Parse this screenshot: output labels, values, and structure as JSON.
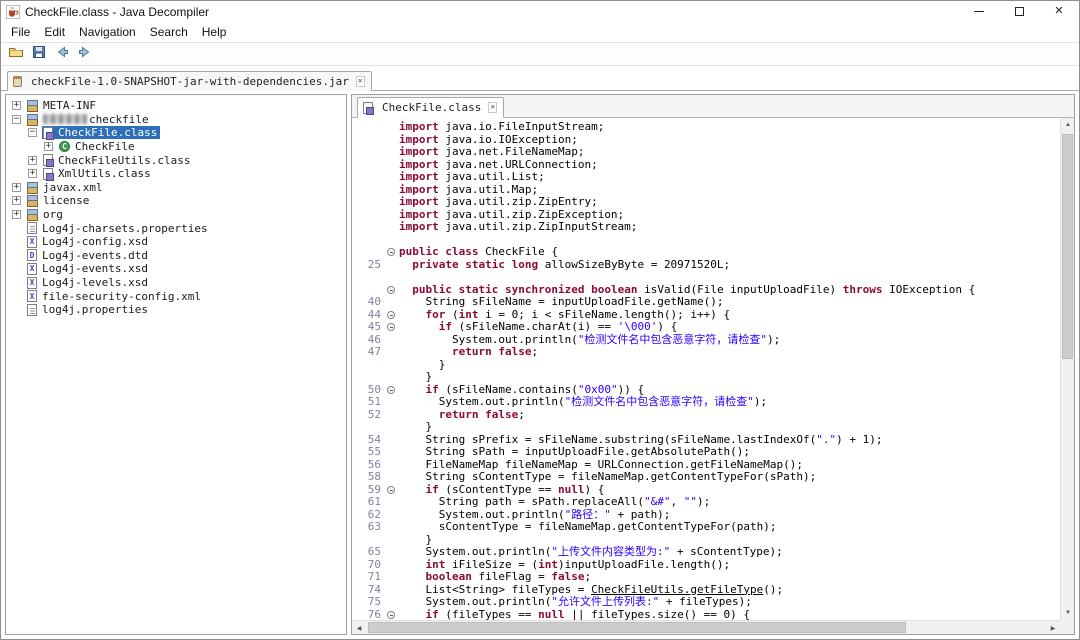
{
  "window": {
    "title": "CheckFile.class - Java Decompiler",
    "close": "✕"
  },
  "menu": {
    "items": [
      "File",
      "Edit",
      "Navigation",
      "Search",
      "Help"
    ]
  },
  "toolbar": {
    "buttons": [
      "open-file",
      "save-all-sources",
      "navigate-back",
      "navigate-forward"
    ]
  },
  "icons": {
    "close": "✕",
    "expander_plus": "+",
    "expander_minus": "−",
    "scroll_up": "▲",
    "scroll_down": "▼",
    "scroll_left": "◀",
    "scroll_right": "▶"
  },
  "colors": {
    "keyword": "#8c0a37",
    "string": "#2a00ff",
    "selection": "#2e6fb8",
    "line_number": "#8080a4"
  },
  "jar_tab": {
    "label": "checkFile-1.0-SNAPSHOT-jar-with-dependencies.jar"
  },
  "tree": {
    "items": [
      {
        "indent": 0,
        "expander": "plus",
        "icon": "package",
        "label": "META-INF"
      },
      {
        "indent": 0,
        "expander": "minus",
        "icon": "package",
        "label": "checkfile",
        "redacted_prefix": true
      },
      {
        "indent": 1,
        "expander": "minus",
        "icon": "class-file",
        "label": "CheckFile.class",
        "selected": true
      },
      {
        "indent": 2,
        "expander": "plus",
        "icon": "class-green",
        "label": "CheckFile"
      },
      {
        "indent": 1,
        "expander": "plus",
        "icon": "class-file",
        "label": "CheckFileUtils.class"
      },
      {
        "indent": 1,
        "expander": "plus",
        "icon": "class-file",
        "label": "XmlUtils.class"
      },
      {
        "indent": 0,
        "expander": "plus",
        "icon": "package",
        "label": "javax.xml"
      },
      {
        "indent": 0,
        "expander": "plus",
        "icon": "package",
        "label": "license"
      },
      {
        "indent": 0,
        "expander": "plus",
        "icon": "package",
        "label": "org"
      },
      {
        "indent": 0,
        "expander": null,
        "icon": "props-file",
        "label": "Log4j-charsets.properties"
      },
      {
        "indent": 0,
        "expander": null,
        "icon": "x-file",
        "label": "Log4j-config.xsd"
      },
      {
        "indent": 0,
        "expander": null,
        "icon": "d-file",
        "label": "Log4j-events.dtd"
      },
      {
        "indent": 0,
        "expander": null,
        "icon": "x-file",
        "label": "Log4j-events.xsd"
      },
      {
        "indent": 0,
        "expander": null,
        "icon": "x-file",
        "label": "Log4j-levels.xsd"
      },
      {
        "indent": 0,
        "expander": null,
        "icon": "x-file",
        "label": "file-security-config.xml"
      },
      {
        "indent": 0,
        "expander": null,
        "icon": "props-file",
        "label": "log4j.properties"
      }
    ]
  },
  "editor": {
    "tab": {
      "label": "CheckFile.class"
    },
    "lines": [
      {
        "seg": [
          [
            "k",
            "import"
          ],
          [
            "p",
            " java.io.FileInputStream;"
          ]
        ]
      },
      {
        "seg": [
          [
            "k",
            "import"
          ],
          [
            "p",
            " java.io.IOException;"
          ]
        ]
      },
      {
        "seg": [
          [
            "k",
            "import"
          ],
          [
            "p",
            " java.net.FileNameMap;"
          ]
        ]
      },
      {
        "seg": [
          [
            "k",
            "import"
          ],
          [
            "p",
            " java.net.URLConnection;"
          ]
        ]
      },
      {
        "seg": [
          [
            "k",
            "import"
          ],
          [
            "p",
            " java.util.List;"
          ]
        ]
      },
      {
        "seg": [
          [
            "k",
            "import"
          ],
          [
            "p",
            " java.util.Map;"
          ]
        ]
      },
      {
        "seg": [
          [
            "k",
            "import"
          ],
          [
            "p",
            " java.util.zip.ZipEntry;"
          ]
        ]
      },
      {
        "seg": [
          [
            "k",
            "import"
          ],
          [
            "p",
            " java.util.zip.ZipException;"
          ]
        ]
      },
      {
        "seg": [
          [
            "k",
            "import"
          ],
          [
            "p",
            " java.util.zip.ZipInputStream;"
          ]
        ]
      },
      {
        "seg": []
      },
      {
        "fold": true,
        "seg": [
          [
            "k",
            "public"
          ],
          [
            "p",
            " "
          ],
          [
            "k",
            "class"
          ],
          [
            "p",
            " CheckFile {"
          ]
        ]
      },
      {
        "n": "25",
        "seg": [
          [
            "p",
            "  "
          ],
          [
            "k",
            "private"
          ],
          [
            "p",
            " "
          ],
          [
            "k",
            "static"
          ],
          [
            "p",
            " "
          ],
          [
            "k",
            "long"
          ],
          [
            "p",
            " allowSizeByByte = 20971520L;"
          ]
        ]
      },
      {
        "seg": []
      },
      {
        "fold": true,
        "seg": [
          [
            "p",
            "  "
          ],
          [
            "k",
            "public"
          ],
          [
            "p",
            " "
          ],
          [
            "k",
            "static"
          ],
          [
            "p",
            " "
          ],
          [
            "k",
            "synchronized"
          ],
          [
            "p",
            " "
          ],
          [
            "k",
            "boolean"
          ],
          [
            "p",
            " isValid(File inputUploadFile) "
          ],
          [
            "k",
            "throws"
          ],
          [
            "p",
            " IOException {"
          ]
        ]
      },
      {
        "n": "40",
        "seg": [
          [
            "p",
            "    String sFileName = inputUploadFile.getName();"
          ]
        ]
      },
      {
        "n": "44",
        "fold": true,
        "seg": [
          [
            "p",
            "    "
          ],
          [
            "k",
            "for"
          ],
          [
            "p",
            " ("
          ],
          [
            "k",
            "int"
          ],
          [
            "p",
            " i = 0; i < sFileName.length(); i++) {"
          ]
        ]
      },
      {
        "n": "45",
        "fold": true,
        "seg": [
          [
            "p",
            "      "
          ],
          [
            "k",
            "if"
          ],
          [
            "p",
            " (sFileName.charAt(i) == "
          ],
          [
            "s",
            "'\\000'"
          ],
          [
            "p",
            ") {"
          ]
        ]
      },
      {
        "n": "46",
        "seg": [
          [
            "p",
            "        System.out.println("
          ],
          [
            "s",
            "\"检测文件名中包含恶意字符，请检查\""
          ],
          [
            "p",
            ");"
          ]
        ]
      },
      {
        "n": "47",
        "seg": [
          [
            "p",
            "        "
          ],
          [
            "k",
            "return"
          ],
          [
            "p",
            " "
          ],
          [
            "k",
            "false"
          ],
          [
            "p",
            ";"
          ]
        ]
      },
      {
        "seg": [
          [
            "p",
            "      }"
          ]
        ]
      },
      {
        "seg": [
          [
            "p",
            "    }"
          ]
        ]
      },
      {
        "n": "50",
        "fold": true,
        "seg": [
          [
            "p",
            "    "
          ],
          [
            "k",
            "if"
          ],
          [
            "p",
            " (sFileName.contains("
          ],
          [
            "s",
            "\"0x00\""
          ],
          [
            "p",
            ")) {"
          ]
        ]
      },
      {
        "n": "51",
        "seg": [
          [
            "p",
            "      System.out.println("
          ],
          [
            "s",
            "\"检测文件名中包含恶意字符，请检查\""
          ],
          [
            "p",
            ");"
          ]
        ]
      },
      {
        "n": "52",
        "seg": [
          [
            "p",
            "      "
          ],
          [
            "k",
            "return"
          ],
          [
            "p",
            " "
          ],
          [
            "k",
            "false"
          ],
          [
            "p",
            ";"
          ]
        ]
      },
      {
        "seg": [
          [
            "p",
            "    }"
          ]
        ]
      },
      {
        "n": "54",
        "seg": [
          [
            "p",
            "    String sPrefix = sFileName.substring(sFileName.lastIndexOf("
          ],
          [
            "s",
            "\".\""
          ],
          [
            "p",
            ") + 1);"
          ]
        ]
      },
      {
        "n": "55",
        "seg": [
          [
            "p",
            "    String sPath = inputUploadFile.getAbsolutePath();"
          ]
        ]
      },
      {
        "n": "56",
        "seg": [
          [
            "p",
            "    FileNameMap fileNameMap = URLConnection.getFileNameMap();"
          ]
        ]
      },
      {
        "n": "58",
        "seg": [
          [
            "p",
            "    String sContentType = fileNameMap.getContentTypeFor(sPath);"
          ]
        ]
      },
      {
        "n": "59",
        "fold": true,
        "seg": [
          [
            "p",
            "    "
          ],
          [
            "k",
            "if"
          ],
          [
            "p",
            " (sContentType == "
          ],
          [
            "k",
            "null"
          ],
          [
            "p",
            ") {"
          ]
        ]
      },
      {
        "n": "61",
        "seg": [
          [
            "p",
            "      String path = sPath.replaceAll("
          ],
          [
            "s",
            "\"&#\""
          ],
          [
            "p",
            ", "
          ],
          [
            "s",
            "\"\""
          ],
          [
            "p",
            ");"
          ]
        ]
      },
      {
        "n": "62",
        "seg": [
          [
            "p",
            "      System.out.println("
          ],
          [
            "s",
            "\"路径：\""
          ],
          [
            "p",
            " + path);"
          ]
        ]
      },
      {
        "n": "63",
        "seg": [
          [
            "p",
            "      sContentType = fileNameMap.getContentTypeFor(path);"
          ]
        ]
      },
      {
        "seg": [
          [
            "p",
            "    }"
          ]
        ]
      },
      {
        "n": "65",
        "seg": [
          [
            "p",
            "    System.out.println("
          ],
          [
            "s",
            "\"上传文件内容类型为:\""
          ],
          [
            "p",
            " + sContentType);"
          ]
        ]
      },
      {
        "n": "70",
        "seg": [
          [
            "p",
            "    "
          ],
          [
            "k",
            "int"
          ],
          [
            "p",
            " iFileSize = ("
          ],
          [
            "k",
            "int"
          ],
          [
            "p",
            ")inputUploadFile.length();"
          ]
        ]
      },
      {
        "n": "71",
        "seg": [
          [
            "p",
            "    "
          ],
          [
            "k",
            "boolean"
          ],
          [
            "p",
            " fileFlag = "
          ],
          [
            "k",
            "false"
          ],
          [
            "p",
            ";"
          ]
        ]
      },
      {
        "n": "74",
        "seg": [
          [
            "p",
            "    List<String> fileTypes = "
          ],
          [
            "l",
            "CheckFileUtils.getFileType"
          ],
          [
            "p",
            "();"
          ]
        ]
      },
      {
        "n": "75",
        "seg": [
          [
            "p",
            "    System.out.println("
          ],
          [
            "s",
            "\"允许文件上传列表:\""
          ],
          [
            "p",
            " + fileTypes);"
          ]
        ]
      },
      {
        "n": "76",
        "fold": true,
        "seg": [
          [
            "p",
            "    "
          ],
          [
            "k",
            "if"
          ],
          [
            "p",
            " (fileTypes == "
          ],
          [
            "k",
            "null"
          ],
          [
            "p",
            " || fileTypes.size() == 0) {"
          ]
        ]
      }
    ]
  }
}
